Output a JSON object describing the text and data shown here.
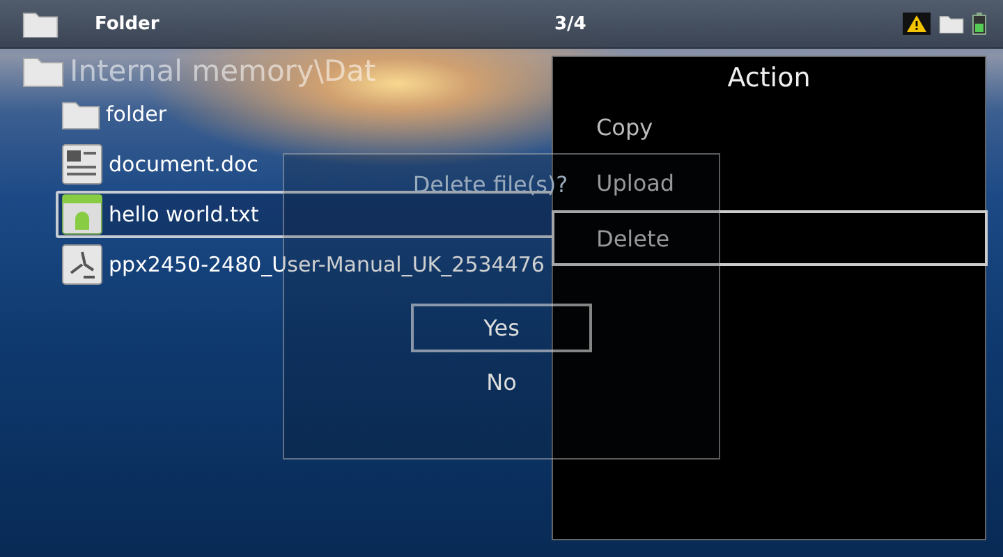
{
  "status_bar": {
    "title": "Folder",
    "page": "3/4"
  },
  "path": "Internal memory\\Dat",
  "files": [
    {
      "name": "folder",
      "kind": "folder",
      "selected": false
    },
    {
      "name": "document.doc",
      "kind": "doc",
      "selected": false
    },
    {
      "name": "hello world.txt",
      "kind": "text",
      "selected": true
    },
    {
      "name": "ppx2450-2480_User-Manual_UK_2534476",
      "kind": "pdf",
      "selected": false
    }
  ],
  "action_menu": {
    "title": "Action",
    "items": [
      {
        "label": "Copy",
        "selected": false
      },
      {
        "label": "Upload",
        "selected": false
      },
      {
        "label": "Delete",
        "selected": true
      }
    ]
  },
  "dialog": {
    "message": "Delete file(s)?",
    "buttons": [
      {
        "label": "Yes",
        "selected": true
      },
      {
        "label": "No",
        "selected": false
      }
    ]
  }
}
